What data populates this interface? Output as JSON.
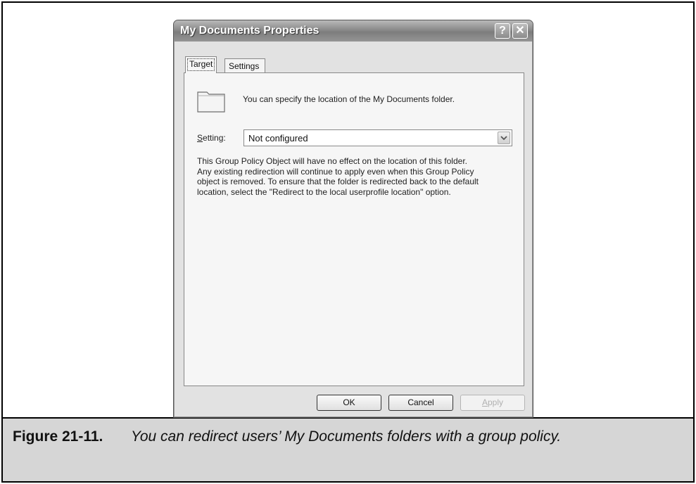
{
  "dialog": {
    "title": "My Documents Properties",
    "help_glyph": "?",
    "close_glyph": "✕",
    "tabs": [
      {
        "label": "Target",
        "selected": true
      },
      {
        "label": "Settings",
        "selected": false
      }
    ],
    "info_text": "You can specify the location of the My Documents folder.",
    "setting": {
      "label_underlined": "S",
      "label_rest": "etting:",
      "value": "Not configured"
    },
    "description_lines": [
      "This Group Policy Object will have no effect on the location of this folder.",
      "Any existing redirection will continue to apply even when this Group Policy",
      "object is removed. To ensure that the folder is redirected back to the default",
      "location, select the \"Redirect to the local userprofile location\" option."
    ],
    "buttons": {
      "ok": "OK",
      "cancel": "Cancel",
      "apply_underlined": "A",
      "apply_rest": "pply"
    }
  },
  "figure": {
    "number": "Figure 21-11.",
    "caption": "You can redirect users’ My Documents folders with a group policy."
  },
  "icons": {
    "folder": "folder-icon",
    "dropdown": "chevron-down-icon",
    "help": "help-icon",
    "close": "close-icon"
  },
  "colors": {
    "caption_background": "#d6d6d6",
    "titlebar": "#8a8a8a",
    "dialog_background": "#e2e2e2"
  }
}
